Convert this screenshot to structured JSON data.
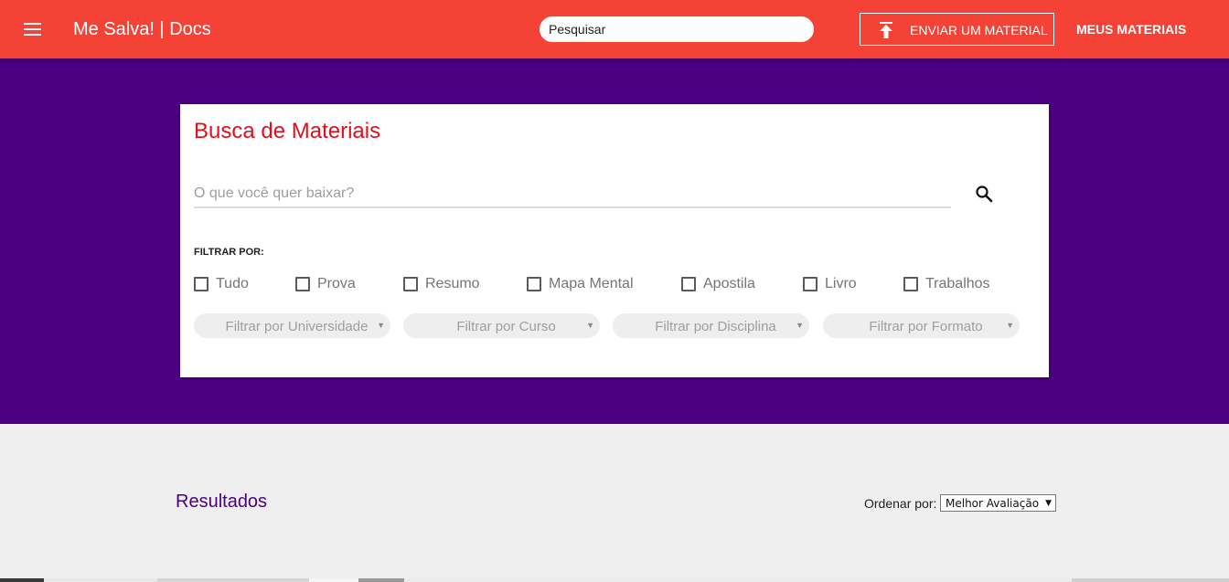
{
  "header": {
    "brand": "Me Salva! | Docs",
    "search_placeholder": "Pesquisar",
    "upload_label": "ENVIAR UM MATERIAL",
    "my_materials_label": "MEUS MATERIAIS",
    "icons": {
      "menu": "hamburger-menu-icon",
      "upload": "upload-arrow-icon"
    },
    "color": "#f44336"
  },
  "hero": {
    "color": "#4a0080",
    "card": {
      "title": "Busca de Materiais",
      "search_placeholder": "O que você quer baixar?",
      "search_icon": "magnifier-icon",
      "filter_label": "FILTRAR POR:",
      "checkboxes": [
        {
          "label": "Tudo",
          "checked": false
        },
        {
          "label": "Prova",
          "checked": false
        },
        {
          "label": "Resumo",
          "checked": false
        },
        {
          "label": "Mapa Mental",
          "checked": false
        },
        {
          "label": "Apostila",
          "checked": false
        },
        {
          "label": "Livro",
          "checked": false
        },
        {
          "label": "Trabalhos",
          "checked": false
        }
      ],
      "selects": [
        {
          "label": "Filtrar por Universidade"
        },
        {
          "label": "Filtrar por Curso"
        },
        {
          "label": "Filtrar por Disciplina"
        },
        {
          "label": "Filtrar por Formato"
        }
      ]
    }
  },
  "results": {
    "title": "Resultados",
    "order_label": "Ordenar por:",
    "order_value": "Melhor Avaliação"
  },
  "colors": {
    "title_red": "#e30e1b",
    "results_purple": "#4a0080"
  }
}
